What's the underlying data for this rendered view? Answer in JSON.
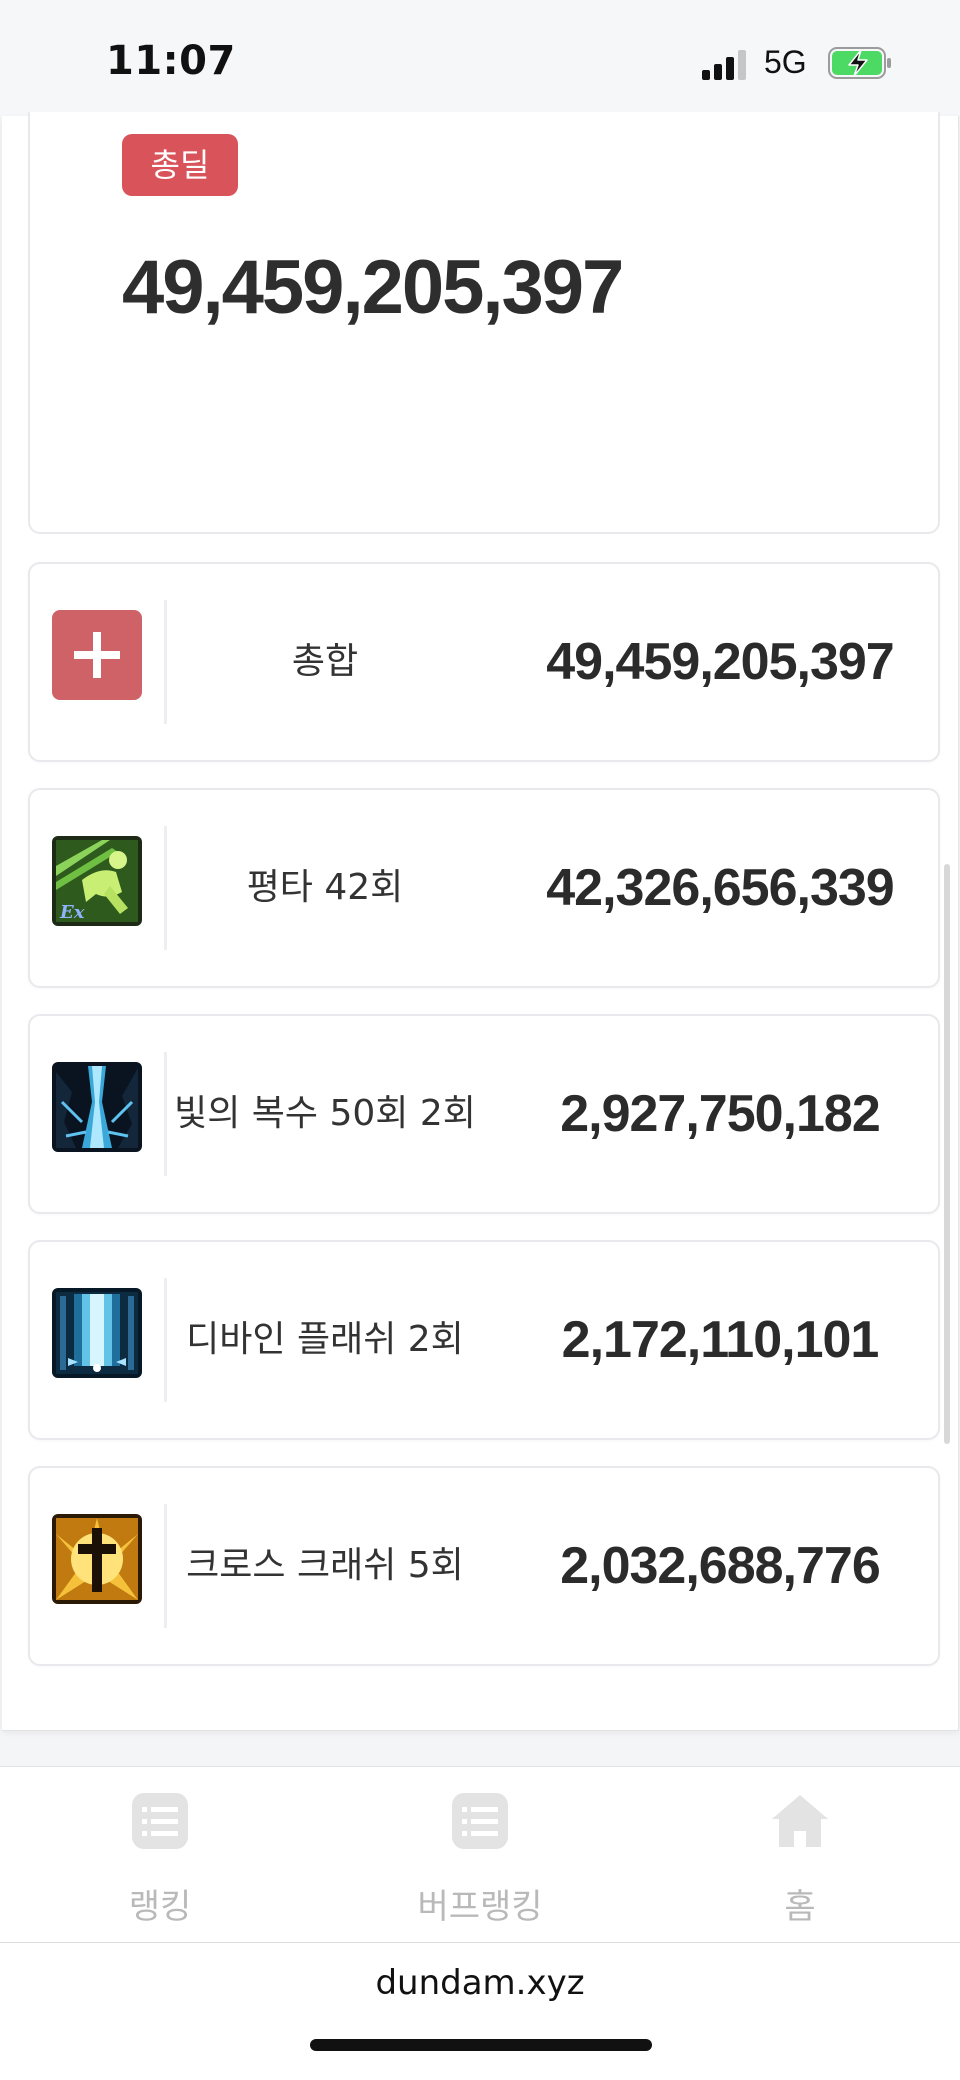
{
  "status": {
    "time": "11:07",
    "network": "5G"
  },
  "summary": {
    "badge": "총딜",
    "total": "49,459,205,397"
  },
  "skills": [
    {
      "name": "총합",
      "damage": "49,459,205,397",
      "icon": "plus-icon"
    },
    {
      "name": "평타 42회",
      "damage": "42,326,656,339",
      "icon": "basic-attack-skill-icon"
    },
    {
      "name": "빛의 복수 50회 2회",
      "damage": "2,927,750,182",
      "icon": "light-revenge-skill-icon"
    },
    {
      "name": "디바인 플래쉬 2회",
      "damage": "2,172,110,101",
      "icon": "divine-flash-skill-icon"
    },
    {
      "name": "크로스 크래쉬 5회",
      "damage": "2,032,688,776",
      "icon": "cross-crash-skill-icon"
    }
  ],
  "nav": {
    "items": [
      {
        "label": "랭킹",
        "icon": "list-icon"
      },
      {
        "label": "버프랭킹",
        "icon": "list-icon"
      },
      {
        "label": "홈",
        "icon": "home-icon"
      }
    ]
  },
  "browser": {
    "url": "dundam.xyz"
  },
  "colors": {
    "badge": "#d9545a",
    "expand_button": "#cf6266",
    "nav_icon": "#e3e3e3"
  }
}
